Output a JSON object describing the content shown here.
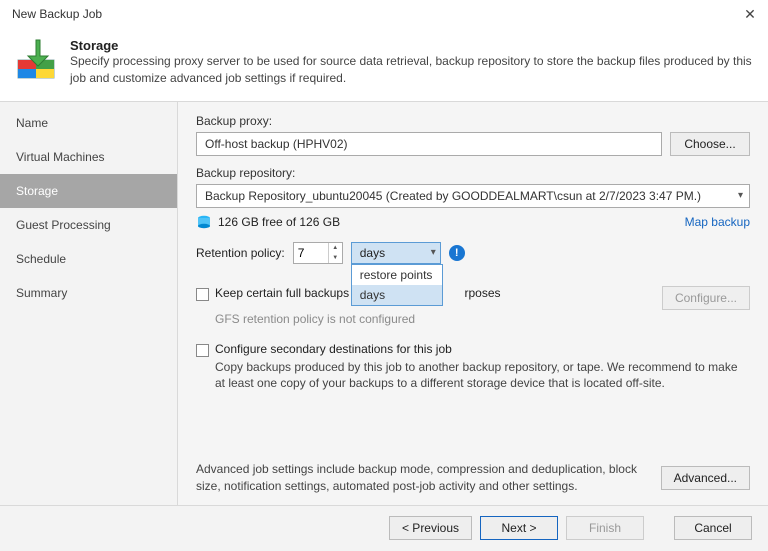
{
  "window": {
    "title": "New Backup Job"
  },
  "header": {
    "title": "Storage",
    "desc": "Specify processing proxy server to be used for source data retrieval, backup repository to store the backup files produced by this job and customize advanced job settings if required."
  },
  "sidebar": {
    "items": [
      {
        "label": "Name"
      },
      {
        "label": "Virtual Machines"
      },
      {
        "label": "Storage"
      },
      {
        "label": "Guest Processing"
      },
      {
        "label": "Schedule"
      },
      {
        "label": "Summary"
      }
    ],
    "active_index": 2
  },
  "main": {
    "proxy_label": "Backup proxy:",
    "proxy_value": "Off-host backup (HPHV02)",
    "choose_btn": "Choose...",
    "repo_label": "Backup repository:",
    "repo_value": "Backup Repository_ubuntu20045 (Created by GOODDEALMART\\csun at 2/7/2023 3:47 PM.)",
    "free_text": "126 GB free of 126 GB",
    "map_link": "Map backup",
    "retention_label": "Retention policy:",
    "retention_value": "7",
    "retention_unit": "days",
    "retention_options": [
      "restore points",
      "days"
    ],
    "keep_full_label": "Keep certain full backups longer for archival purposes",
    "keep_full_sub_visible": "Keep certain full backups lo",
    "keep_full_sub_visible_tail": "rposes",
    "gfs_note": "GFS retention policy is not configured",
    "configure_btn": "Configure...",
    "secondary_label": "Configure secondary destinations for this job",
    "secondary_desc": "Copy backups produced by this job to another backup repository, or tape. We recommend to make at least one copy of your backups to a different storage device that is located off-site.",
    "adv_text": "Advanced job settings include backup mode, compression and deduplication, block size, notification settings, automated post-job activity and other settings.",
    "adv_btn": "Advanced..."
  },
  "footer": {
    "prev": "< Previous",
    "next": "Next >",
    "finish": "Finish",
    "cancel": "Cancel"
  }
}
